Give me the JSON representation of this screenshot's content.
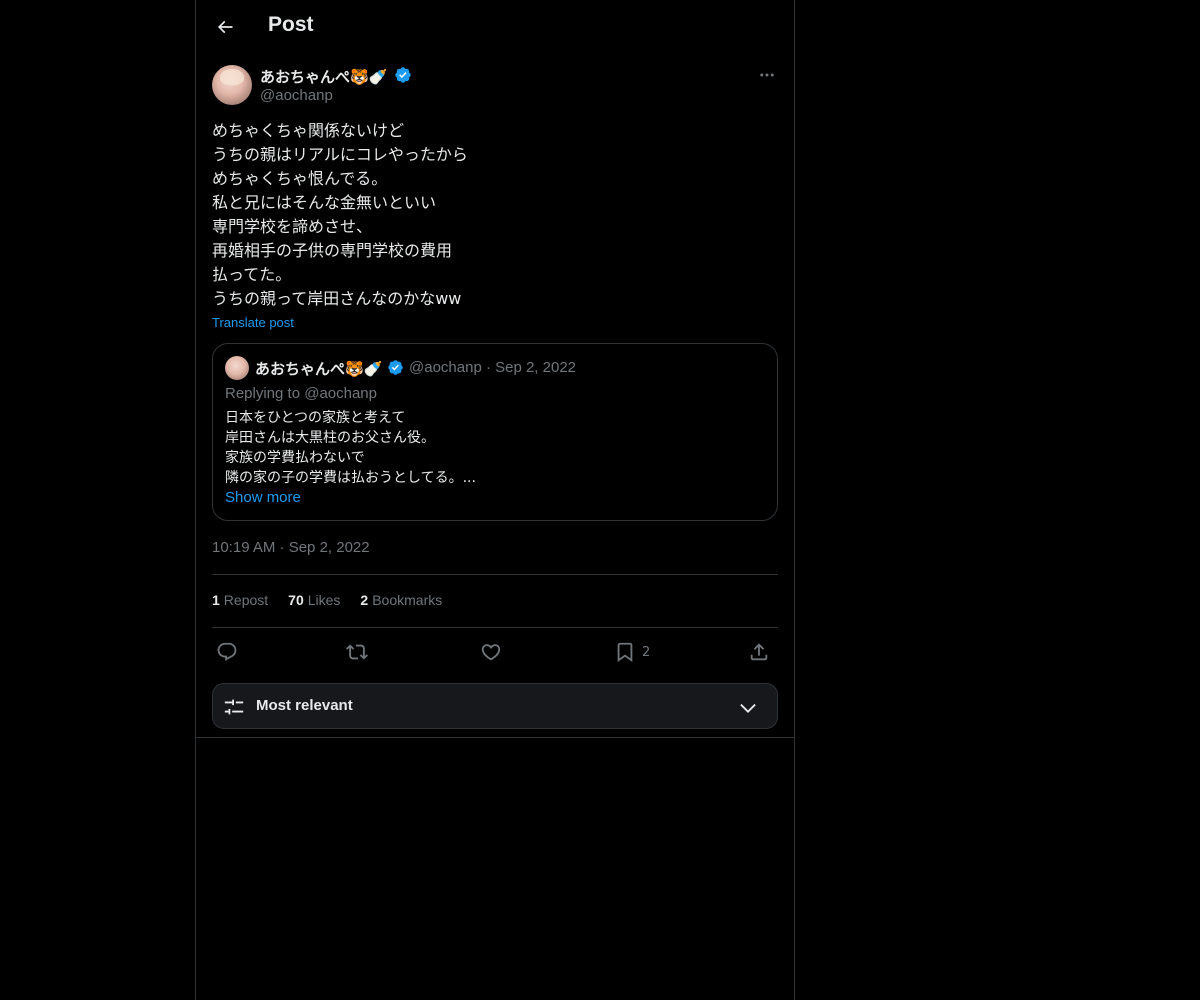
{
  "header": {
    "title": "Post"
  },
  "author": {
    "display_name": "あおちゃんぺ🐯🍼",
    "handle": "@aochanp",
    "verified": true
  },
  "post": {
    "text": "めちゃくちゃ関係ないけど\nうちの親はリアルにコレやったから\nめちゃくちゃ恨んでる。\n私と兄にはそんな金無いといい\n専門学校を諦めさせ、\n再婚相手の子供の専門学校の費用\n払ってた。\nうちの親って岸田さんなのかなww",
    "translate_label": "Translate post",
    "timestamp": "10:19 AM · Sep 2, 2022"
  },
  "quote": {
    "display_name": "あおちゃんぺ🐯🍼",
    "handle_date": "@aochanp · Sep 2, 2022",
    "replying_to": "Replying to @aochanp",
    "text": "日本をひとつの家族と考えて\n岸田さんは大黒柱のお父さん役。\n家族の学費払わないで\n隣の家の子の学費は払おうとしてる。...",
    "show_more": "Show more"
  },
  "stats": {
    "reposts_count": "1",
    "reposts_label": "Repost",
    "likes_count": "70",
    "likes_label": "Likes",
    "bookmarks_count": "2",
    "bookmarks_label": "Bookmarks"
  },
  "actions": {
    "reply_icon": "reply-icon",
    "repost_icon": "repost-icon",
    "like_icon": "heart-icon",
    "bookmark_icon": "bookmark-icon",
    "bookmark_count": "2",
    "share_icon": "share-icon"
  },
  "sort": {
    "label": "Most relevant"
  },
  "colors": {
    "background": "#000000",
    "text": "#e7e9ea",
    "muted": "#71767b",
    "accent": "#1d9bf0",
    "border": "#2f3336"
  }
}
